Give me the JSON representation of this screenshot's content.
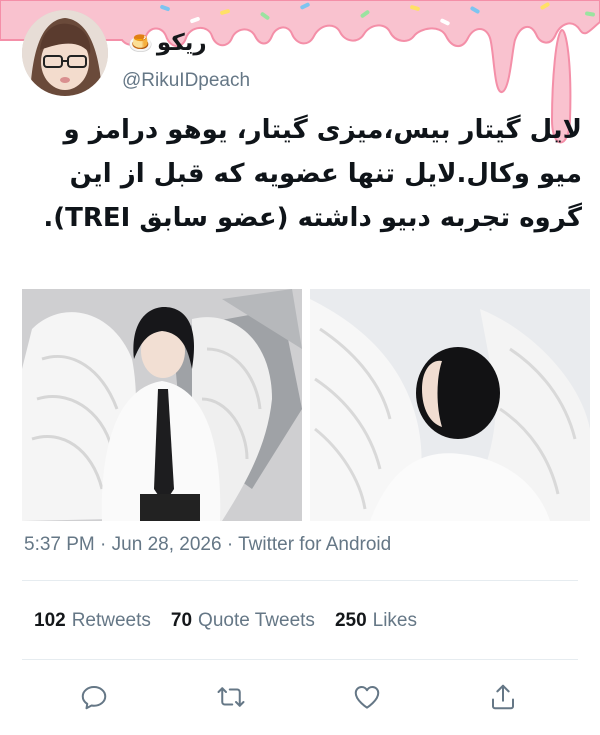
{
  "author": {
    "display_name": "ریکو",
    "name_emoji": "🍮",
    "username": "@RikuIDpeach"
  },
  "tweet": {
    "text": "لایل گیتار بیس،میزی گیتار، یوهو درامز و میو وکال.لایل تنها عضویه که قبل از این گروه تجربه دبیو داشته (عضو سابق TREI).",
    "images": [
      {
        "icon": "person-with-angel-wings-photo"
      },
      {
        "icon": "head-in-angel-wings-photo"
      }
    ]
  },
  "meta": {
    "time": "5:37 PM",
    "separator1": "·",
    "date": "Jun 28, 2026",
    "separator2": "·",
    "source": "Twitter for Android"
  },
  "stats": {
    "retweets_count": "102",
    "retweets_label": "Retweets",
    "quotes_count": "70",
    "quotes_label": "Quote Tweets",
    "likes_count": "250",
    "likes_label": "Likes"
  },
  "actions": {
    "reply_icon": "reply-icon",
    "retweet_icon": "retweet-icon",
    "like_icon": "like-icon",
    "share_icon": "share-icon"
  },
  "colors": {
    "secondary_text": "#657786",
    "drip_pink": "#f7b5c4",
    "drip_outline": "#f48fa8"
  }
}
